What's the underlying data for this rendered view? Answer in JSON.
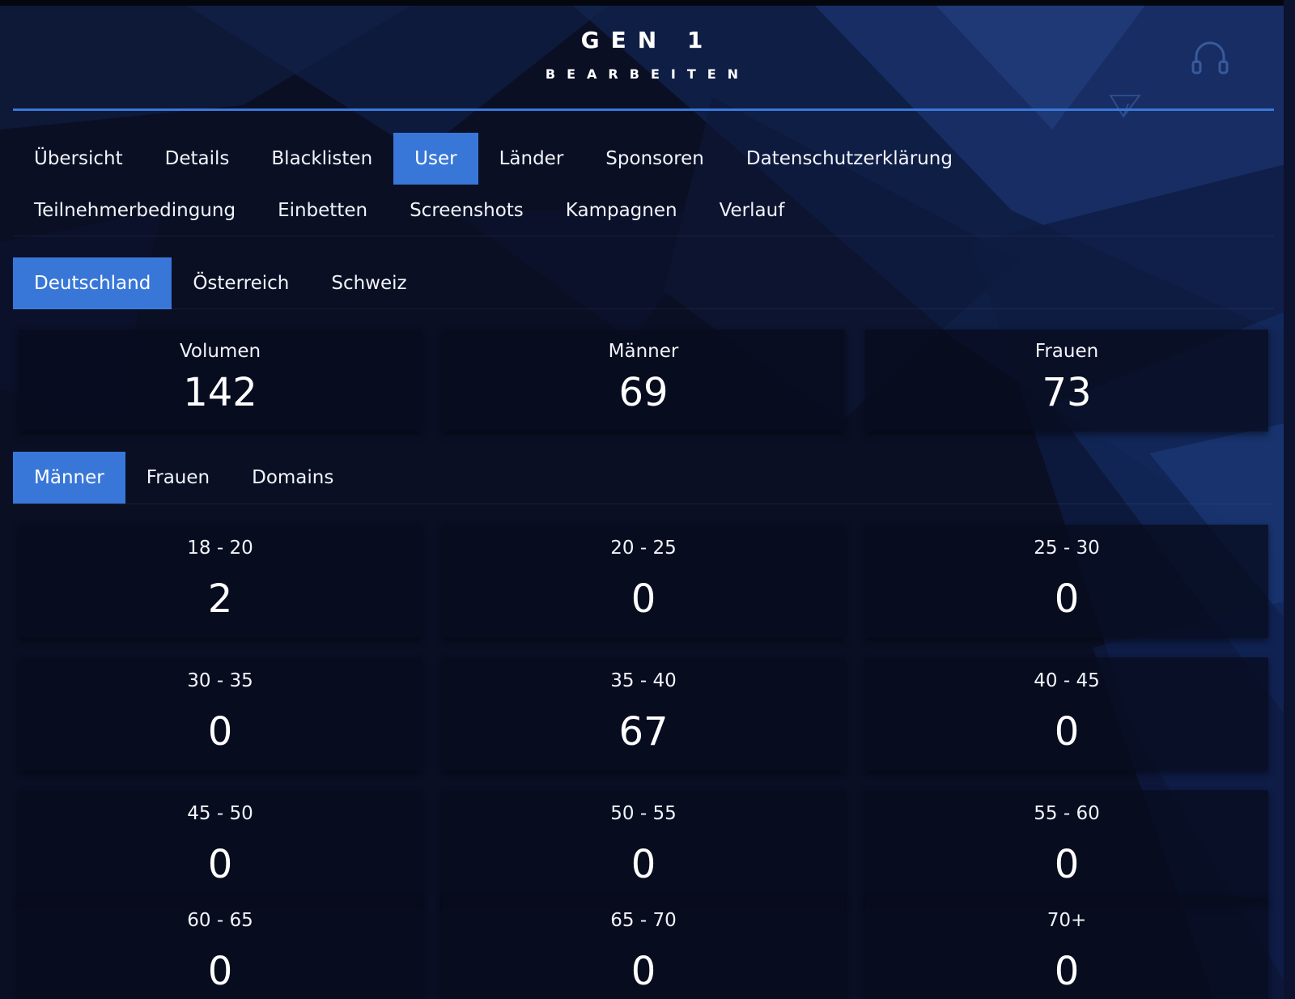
{
  "header": {
    "title": "GEN 1",
    "subtitle": "BEARBEITEN"
  },
  "icons": {
    "top_right": "headset-icon",
    "decor": "paper-plane-icon"
  },
  "colors": {
    "accent": "#3877d8",
    "background": "#0a0f24",
    "card": "#0b1029"
  },
  "main_tabs": [
    {
      "label": "Übersicht",
      "active": false
    },
    {
      "label": "Details",
      "active": false
    },
    {
      "label": "Blacklisten",
      "active": false
    },
    {
      "label": "User",
      "active": true
    },
    {
      "label": "Länder",
      "active": false
    },
    {
      "label": "Sponsoren",
      "active": false
    },
    {
      "label": "Datenschutzerklärung",
      "active": false
    },
    {
      "label": "Teilnehmerbedingung",
      "active": false
    },
    {
      "label": "Einbetten",
      "active": false
    },
    {
      "label": "Screenshots",
      "active": false
    },
    {
      "label": "Kampagnen",
      "active": false
    },
    {
      "label": "Verlauf",
      "active": false
    }
  ],
  "country_tabs": [
    {
      "label": "Deutschland",
      "active": true
    },
    {
      "label": "Österreich",
      "active": false
    },
    {
      "label": "Schweiz",
      "active": false
    }
  ],
  "summary": [
    {
      "label": "Volumen",
      "value": "142"
    },
    {
      "label": "Männer",
      "value": "69"
    },
    {
      "label": "Frauen",
      "value": "73"
    }
  ],
  "gender_tabs": [
    {
      "label": "Männer",
      "active": true
    },
    {
      "label": "Frauen",
      "active": false
    },
    {
      "label": "Domains",
      "active": false
    }
  ],
  "age_groups": [
    {
      "label": "18 - 20",
      "value": "2"
    },
    {
      "label": "20 - 25",
      "value": "0"
    },
    {
      "label": "25 - 30",
      "value": "0"
    },
    {
      "label": "30 - 35",
      "value": "0"
    },
    {
      "label": "35 - 40",
      "value": "67"
    },
    {
      "label": "40 - 45",
      "value": "0"
    },
    {
      "label": "45 - 50",
      "value": "0"
    },
    {
      "label": "50 - 55",
      "value": "0"
    },
    {
      "label": "55 - 60",
      "value": "0"
    },
    {
      "label": "60 - 65",
      "value": "0"
    },
    {
      "label": "65 - 70",
      "value": "0"
    },
    {
      "label": "70+",
      "value": "0"
    }
  ]
}
